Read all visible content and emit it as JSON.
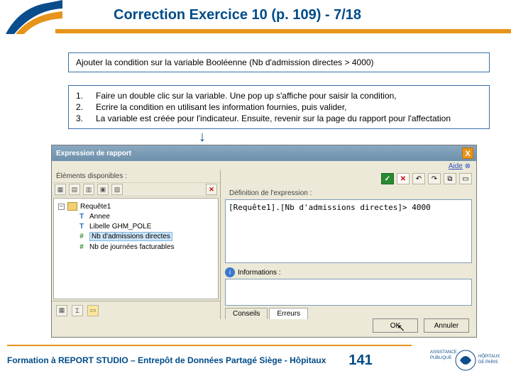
{
  "header": {
    "title": "Correction Exercice 10 (p. 109) - 7/18"
  },
  "instruction": "Ajouter la condition sur la variable Booléenne (Nb d'admission directes > 4000)",
  "steps": {
    "nums": [
      "1.",
      "2.",
      "3."
    ],
    "lines": [
      "Faire un double clic sur la variable. Une pop up s'affiche pour saisir la condition,",
      "Ecrire la condition en utilisant les information fournies, puis valider,",
      "La variable est créée pour l'indicateur. Ensuite, revenir sur la page du rapport pour l'affectation"
    ]
  },
  "dialog": {
    "title": "Expression de rapport",
    "help": "Aide",
    "close": "X",
    "leftLabel": "Éléments disponibles :",
    "tree": {
      "root": "Requête1",
      "items": [
        "Annee",
        "Libelle GHM_POLE",
        "Nb d'admissions directes",
        "Nb de journées facturables"
      ]
    },
    "rightLabel": "Définition de l'expression :",
    "expression": "[Requête1].[Nb d'admissions directes]> 4000",
    "infoLabel": "Informations :",
    "tabs": {
      "conseils": "Conseils",
      "erreurs": "Erreurs"
    },
    "buttons": {
      "ok": "OK",
      "cancel": "Annuler"
    }
  },
  "footer": {
    "text": "Formation à REPORT STUDIO – Entrepôt de Données Partagé Siège - Hôpitaux",
    "page": "141",
    "brand1": "ASSISTANCE PUBLIQUE",
    "brand2": "HÔPITAUX DE PARIS"
  }
}
